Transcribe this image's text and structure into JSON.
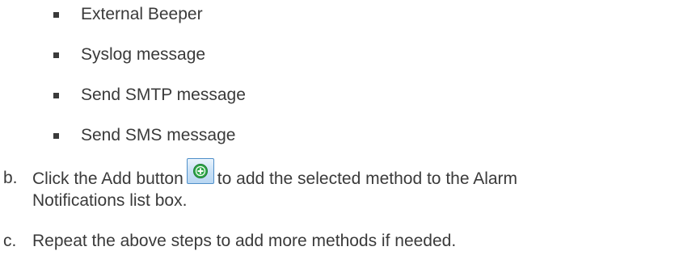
{
  "bullets": [
    "External Beeper",
    "Syslog message",
    "Send SMTP message",
    "Send SMS message"
  ],
  "step_b": {
    "letter": "b.",
    "text_before": "Click the Add button",
    "text_after": "to add the selected method to the Alarm",
    "line2": "Notifications list box.",
    "add_icon": "green-plus-circle-icon"
  },
  "step_c": {
    "letter": "c.",
    "text": "Repeat the above steps to add more methods if needed."
  },
  "colors": {
    "text": "#3a3a3a",
    "add_icon_green": "#2fa84a",
    "add_button_border": "#4f8fc9"
  }
}
